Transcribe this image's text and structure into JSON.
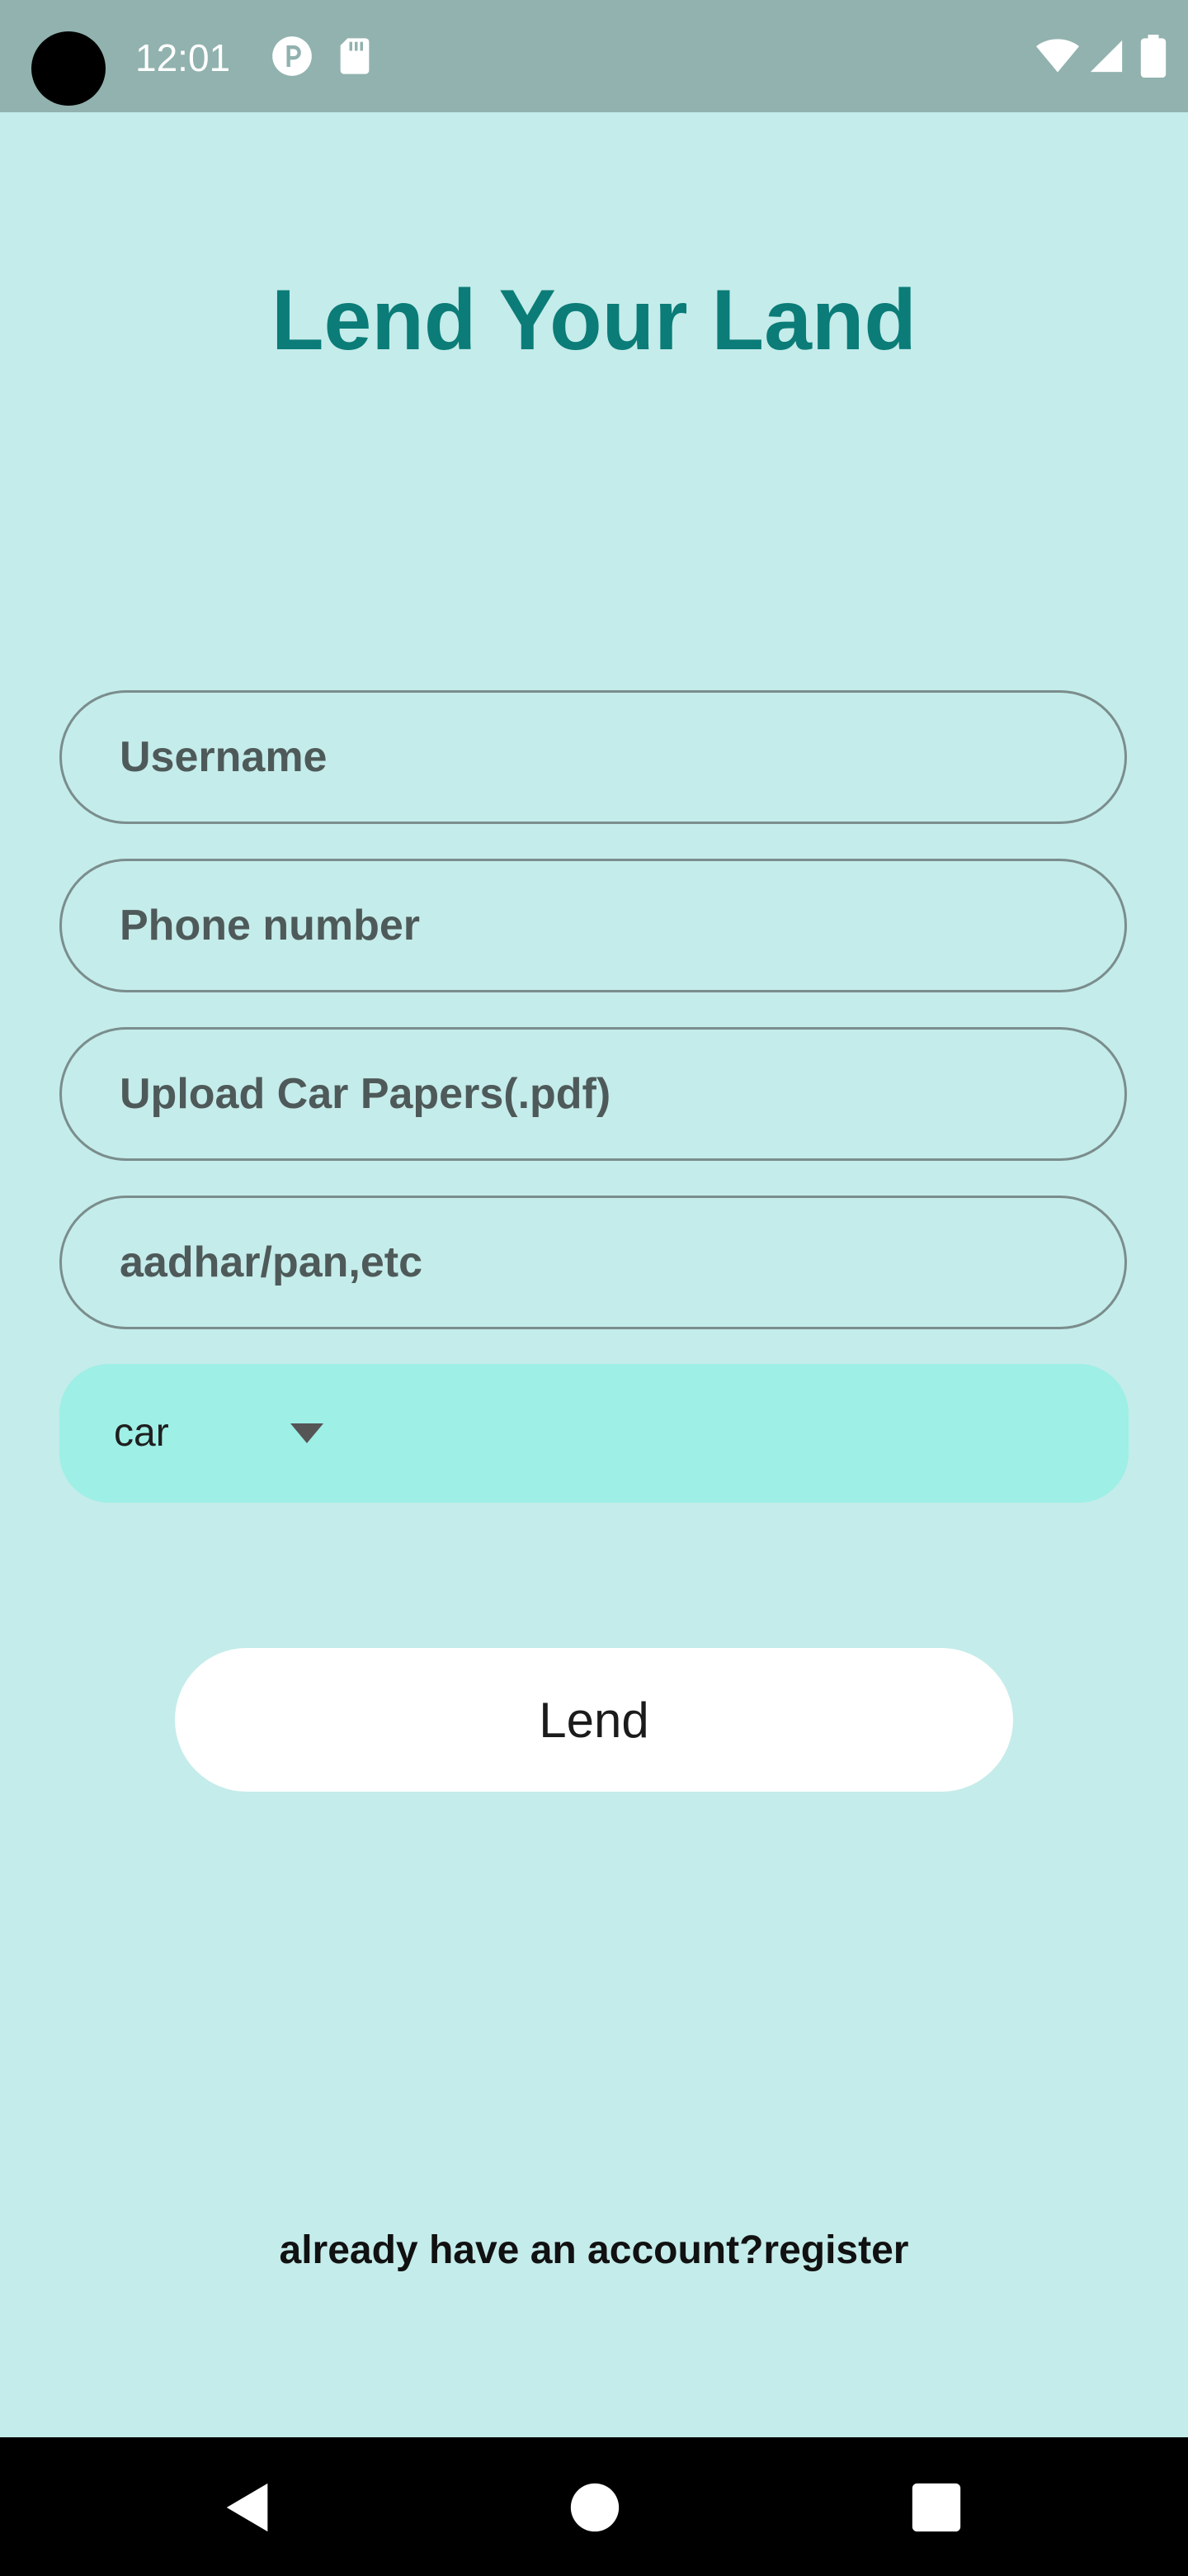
{
  "status_bar": {
    "time": "12:01",
    "icons": [
      "camera-cutout",
      "p-icon",
      "sd-card-icon",
      "wifi-icon",
      "signal-icon",
      "battery-icon"
    ]
  },
  "page": {
    "title": "Lend Your Land"
  },
  "form": {
    "username_placeholder": "Username",
    "phone_placeholder": "Phone number",
    "papers_placeholder": "Upload Car Papers(.pdf)",
    "id_placeholder": "aadhar/pan,etc",
    "vehicle_type_selected": "car",
    "submit_label": "Lend"
  },
  "footer": {
    "register_text": "already have an account?register"
  },
  "nav_bar": {
    "buttons": [
      "back-icon",
      "home-icon",
      "recents-icon"
    ]
  },
  "colors": {
    "background": "#c4ecea",
    "status_bar": "#91b2ae",
    "title": "#0b7c78",
    "dropdown": "#9eefe6",
    "button": "#ffffff"
  }
}
